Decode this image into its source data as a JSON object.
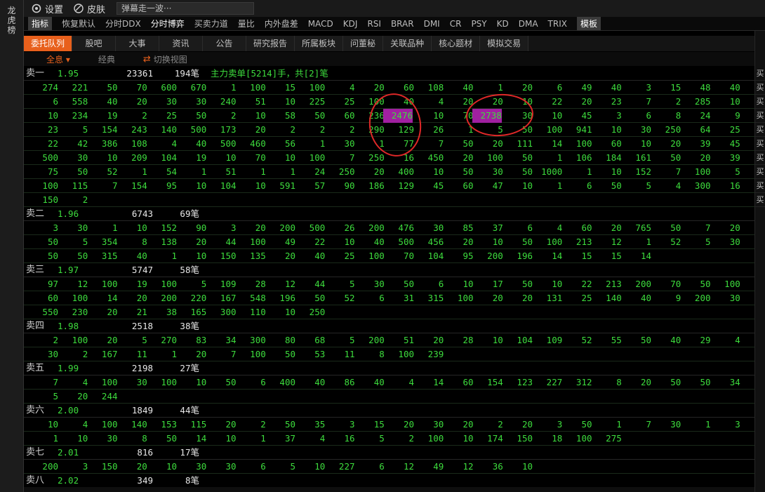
{
  "sidebar": {
    "title_chars": [
      "龙",
      "虎",
      "榜"
    ]
  },
  "topbar": {
    "settings_label": "设置",
    "skin_label": "皮肤",
    "marquee_text": "弹幕走一波···"
  },
  "indicators": {
    "lead": "指标",
    "items": [
      "恢复默认",
      "分时DDX",
      "分时博弈",
      "买卖力道",
      "量比",
      "内外盘差",
      "MACD",
      "KDJ",
      "RSI",
      "BRAR",
      "DMI",
      "CR",
      "PSY",
      "KD",
      "DMA",
      "TRIX"
    ],
    "active_index": 2,
    "template": "模板"
  },
  "tabs": [
    "委托队列",
    "股吧",
    "大事",
    "资讯",
    "公告",
    "研究报告",
    "所属板块",
    "问董秘",
    "关联品种",
    "核心题材",
    "模拟交易"
  ],
  "active_tab": 0,
  "subbar": {
    "all": "全息",
    "classic": "经典",
    "switch": "切换视图"
  },
  "queue": [
    {
      "name": "卖一",
      "price": "1.95",
      "volume": "23361",
      "count": "194",
      "unit": "笔",
      "note": "主力卖单[5214]手，共[2]笔",
      "rows": [
        [
          "274",
          "221",
          "50",
          "70",
          "600",
          "670",
          "1",
          "100",
          "15",
          "100",
          "4",
          "20",
          "60",
          "108",
          "40",
          "1",
          "20",
          "6",
          "49",
          "40",
          "3",
          "15",
          "48",
          "40"
        ],
        [
          "6",
          "558",
          "40",
          "20",
          "30",
          "30",
          "240",
          "51",
          "10",
          "225",
          "25",
          "100",
          "40",
          "4",
          "20",
          "20",
          "10",
          "22",
          "20",
          "23",
          "7",
          "2",
          "285",
          "10"
        ],
        [
          "10",
          "234",
          "19",
          "2",
          "25",
          "50",
          "2",
          "10",
          "58",
          "50",
          "60",
          "236",
          "2476",
          "10",
          "70",
          "2738",
          "30",
          "10",
          "45",
          "3",
          "6",
          "8",
          "24",
          "9"
        ],
        [
          "23",
          "5",
          "154",
          "243",
          "140",
          "500",
          "173",
          "20",
          "2",
          "2",
          "2",
          "290",
          "129",
          "26",
          "1",
          "5",
          "50",
          "100",
          "941",
          "10",
          "30",
          "250",
          "64",
          "25"
        ],
        [
          "22",
          "42",
          "386",
          "108",
          "4",
          "40",
          "500",
          "460",
          "56",
          "1",
          "30",
          "1",
          "77",
          "7",
          "50",
          "20",
          "111",
          "14",
          "100",
          "60",
          "10",
          "20",
          "39",
          "45"
        ],
        [
          "500",
          "30",
          "10",
          "209",
          "104",
          "19",
          "10",
          "70",
          "10",
          "100",
          "7",
          "250",
          "16",
          "450",
          "20",
          "100",
          "50",
          "1",
          "106",
          "184",
          "161",
          "50",
          "20",
          "39"
        ],
        [
          "75",
          "50",
          "52",
          "1",
          "54",
          "1",
          "51",
          "1",
          "1",
          "24",
          "250",
          "20",
          "400",
          "10",
          "50",
          "30",
          "50",
          "1000",
          "1",
          "10",
          "152",
          "7",
          "100",
          "5"
        ],
        [
          "100",
          "115",
          "7",
          "154",
          "95",
          "10",
          "104",
          "10",
          "591",
          "57",
          "90",
          "186",
          "129",
          "45",
          "60",
          "47",
          "10",
          "1",
          "6",
          "50",
          "5",
          "4",
          "300",
          "16"
        ],
        [
          "150",
          "2"
        ]
      ]
    },
    {
      "name": "卖二",
      "price": "1.96",
      "volume": "6743",
      "count": "69",
      "unit": "笔",
      "rows": [
        [
          "3",
          "30",
          "1",
          "10",
          "152",
          "90",
          "3",
          "20",
          "200",
          "500",
          "26",
          "200",
          "476",
          "30",
          "85",
          "37",
          "6",
          "4",
          "60",
          "20",
          "765",
          "50",
          "7",
          "20"
        ],
        [
          "50",
          "5",
          "354",
          "8",
          "138",
          "20",
          "44",
          "100",
          "49",
          "22",
          "10",
          "40",
          "500",
          "456",
          "20",
          "10",
          "50",
          "100",
          "213",
          "12",
          "1",
          "52",
          "5",
          "30"
        ],
        [
          "50",
          "50",
          "315",
          "40",
          "1",
          "10",
          "150",
          "135",
          "20",
          "40",
          "25",
          "100",
          "70",
          "104",
          "95",
          "200",
          "196",
          "14",
          "15",
          "15",
          "14"
        ]
      ]
    },
    {
      "name": "卖三",
      "price": "1.97",
      "volume": "5747",
      "count": "58",
      "unit": "笔",
      "rows": [
        [
          "97",
          "12",
          "100",
          "19",
          "100",
          "5",
          "109",
          "28",
          "12",
          "44",
          "5",
          "30",
          "50",
          "6",
          "10",
          "17",
          "50",
          "10",
          "22",
          "213",
          "200",
          "70",
          "50",
          "100"
        ],
        [
          "60",
          "100",
          "14",
          "20",
          "200",
          "220",
          "167",
          "548",
          "196",
          "50",
          "52",
          "6",
          "31",
          "315",
          "100",
          "20",
          "20",
          "131",
          "25",
          "140",
          "40",
          "9",
          "200",
          "30"
        ],
        [
          "550",
          "230",
          "20",
          "21",
          "38",
          "165",
          "300",
          "110",
          "10",
          "250"
        ]
      ]
    },
    {
      "name": "卖四",
      "price": "1.98",
      "volume": "2518",
      "count": "38",
      "unit": "笔",
      "rows": [
        [
          "2",
          "100",
          "20",
          "5",
          "270",
          "83",
          "34",
          "300",
          "80",
          "68",
          "5",
          "200",
          "51",
          "20",
          "28",
          "10",
          "104",
          "109",
          "52",
          "55",
          "50",
          "40",
          "29",
          "4"
        ],
        [
          "30",
          "2",
          "167",
          "11",
          "1",
          "20",
          "7",
          "100",
          "50",
          "53",
          "11",
          "8",
          "100",
          "239"
        ]
      ]
    },
    {
      "name": "卖五",
      "price": "1.99",
      "volume": "2198",
      "count": "27",
      "unit": "笔",
      "rows": [
        [
          "7",
          "4",
          "100",
          "30",
          "100",
          "10",
          "50",
          "6",
          "400",
          "40",
          "86",
          "40",
          "4",
          "14",
          "60",
          "154",
          "123",
          "227",
          "312",
          "8",
          "20",
          "50",
          "50",
          "34"
        ],
        [
          "5",
          "20",
          "244"
        ]
      ]
    },
    {
      "name": "卖六",
      "price": "2.00",
      "volume": "1849",
      "count": "44",
      "unit": "笔",
      "rows": [
        [
          "10",
          "4",
          "100",
          "140",
          "153",
          "115",
          "20",
          "2",
          "50",
          "35",
          "3",
          "15",
          "20",
          "30",
          "20",
          "2",
          "20",
          "3",
          "50",
          "1",
          "7",
          "30",
          "1",
          "3"
        ],
        [
          "1",
          "10",
          "30",
          "8",
          "50",
          "14",
          "10",
          "1",
          "37",
          "4",
          "16",
          "5",
          "2",
          "100",
          "10",
          "174",
          "150",
          "18",
          "100",
          "275"
        ]
      ]
    },
    {
      "name": "卖七",
      "price": "2.01",
      "volume": "816",
      "count": "17",
      "unit": "笔",
      "rows": [
        [
          "200",
          "3",
          "150",
          "20",
          "10",
          "30",
          "30",
          "6",
          "5",
          "10",
          "227",
          "6",
          "12",
          "49",
          "12",
          "36",
          "10"
        ]
      ]
    },
    {
      "name": "卖八",
      "price": "2.02",
      "volume": "349",
      "count": "8",
      "unit": "笔",
      "rows": []
    }
  ],
  "highlighted_values": [
    "2476",
    "2738"
  ],
  "right_labels": [
    "买",
    "买",
    "买",
    "买",
    "买",
    "买",
    "买",
    "买",
    "买",
    "买"
  ],
  "colors": {
    "accent": "#e8601c",
    "value_green": "#3ddc3d",
    "highlight": "#a020a0",
    "circle": "#e02828"
  }
}
